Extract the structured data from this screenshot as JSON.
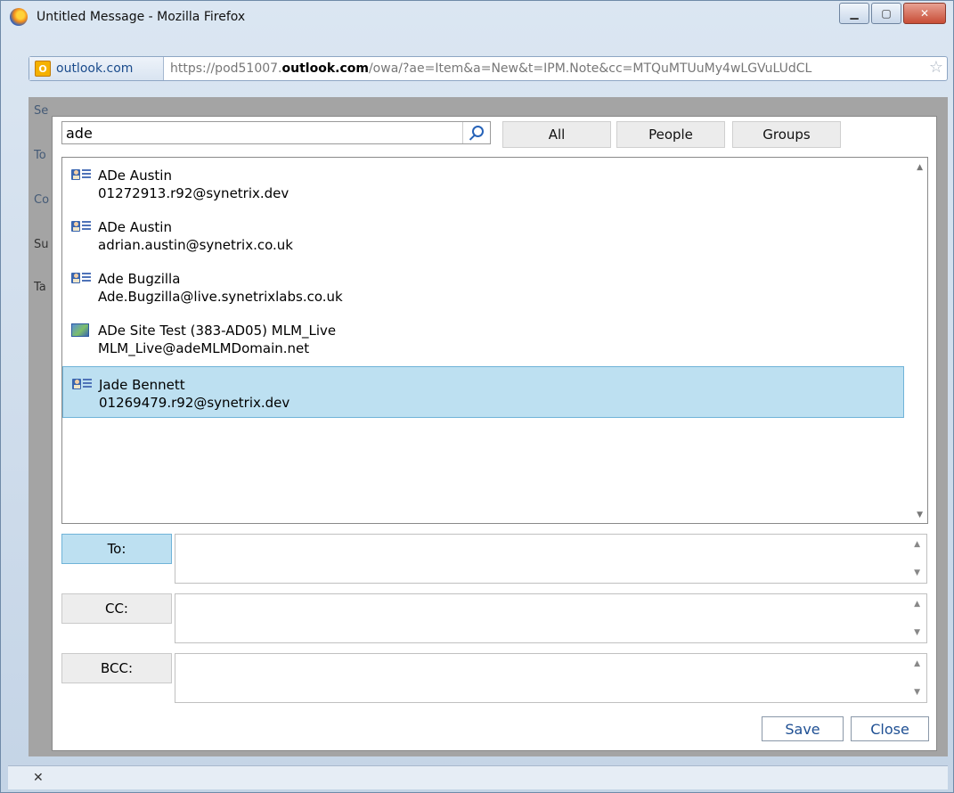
{
  "window": {
    "title": "Untitled Message - Mozilla Firefox"
  },
  "address": {
    "site_label": "outlook.com",
    "url_prefix": "https://pod51007.",
    "url_domain": "outlook.com",
    "url_rest": "/owa/?ae=Item&a=New&t=IPM.Note&cc=MTQuMTUuMy4wLGVuLUdCL"
  },
  "search": {
    "value": "ade",
    "placeholder": ""
  },
  "filters": [
    "All",
    "People",
    "Groups"
  ],
  "results": [
    {
      "name": "ADe Austin",
      "email": "01272913.r92@synetrix.dev",
      "icon": "contact-card-icon",
      "selected": false
    },
    {
      "name": "ADe Austin",
      "email": "adrian.austin@synetrix.co.uk",
      "icon": "contact-card-icon",
      "selected": false
    },
    {
      "name": "Ade Bugzilla",
      "email": "Ade.Bugzilla@live.synetrixlabs.co.uk",
      "icon": "contact-card-icon",
      "selected": false
    },
    {
      "name": "ADe Site Test (383-AD05) MLM_Live",
      "email": "MLM_Live@adeMLMDomain.net",
      "icon": "group-icon",
      "selected": false
    },
    {
      "name": "Jade Bennett",
      "email": "01269479.r92@synetrix.dev",
      "icon": "contact-card-icon",
      "selected": true
    }
  ],
  "recipients": {
    "to_label": "To:",
    "cc_label": "CC:",
    "bcc_label": "BCC:"
  },
  "actions": {
    "save": "Save",
    "close": "Close"
  },
  "background": {
    "partial_labels": [
      "Se",
      "To",
      "Co",
      "Su",
      "Ta"
    ]
  },
  "colors": {
    "selection": "#bde0f1",
    "link": "#1e4f93"
  }
}
